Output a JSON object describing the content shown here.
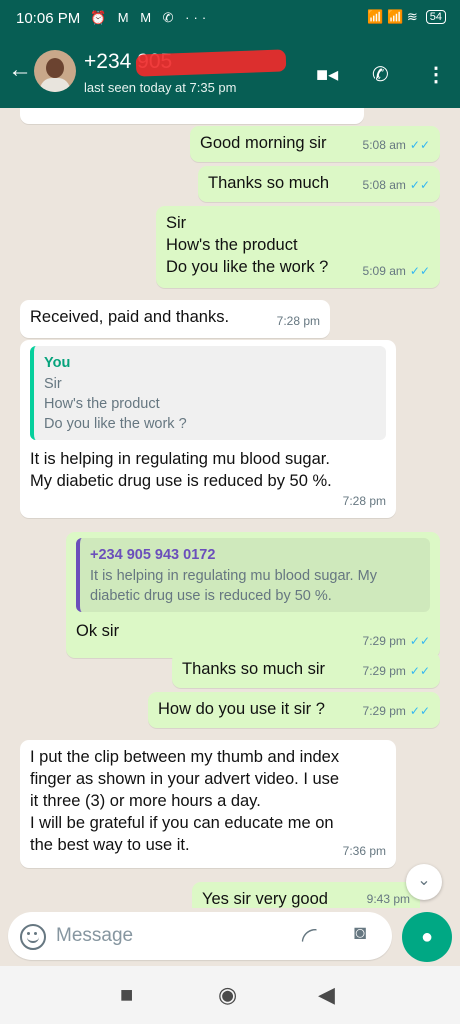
{
  "status_bar": {
    "time": "10:06 PM",
    "left_icons": "⏰ M M ✆ ···",
    "right_icons": "📶 📶 ≋",
    "battery": "54"
  },
  "header": {
    "contact_name": "+234 905",
    "last_seen": "last seen today at 7:35 pm",
    "icons": [
      "back-arrow-icon",
      "video-call-icon",
      "phone-icon",
      "more-vert-icon"
    ]
  },
  "messages": [
    {
      "dir": "out",
      "text": "Good morning sir",
      "time": "5:08 am"
    },
    {
      "dir": "out",
      "text": "Thanks so much",
      "time": "5:08 am"
    },
    {
      "dir": "out",
      "lines": [
        "Sir",
        "How's the product",
        "Do you like the work ?"
      ],
      "time": "5:09 am"
    },
    {
      "dir": "in",
      "text": "Received, paid and thanks.",
      "time": "7:28 pm"
    },
    {
      "dir": "in",
      "quote": {
        "name": "You",
        "lines": [
          "Sir",
          "How's the product",
          "Do you like the work ?"
        ]
      },
      "text_lines": [
        "It is helping in regulating mu blood sugar.",
        "My diabetic drug use is reduced by 50 %."
      ],
      "time": "7:28 pm"
    },
    {
      "dir": "out",
      "quote": {
        "name": "+234 905 943 0172",
        "lines": [
          "It is helping in regulating mu blood sugar. My",
          "diabetic drug use is reduced by 50 %."
        ]
      },
      "text": "Ok sir",
      "time": "7:29 pm"
    },
    {
      "dir": "out",
      "text": "Thanks so much sir",
      "time": "7:29 pm"
    },
    {
      "dir": "out",
      "text": "How do you use it sir ?",
      "time": "7:29 pm"
    },
    {
      "dir": "in",
      "lines": [
        "I put the clip between my thumb and index",
        "finger as shown in your advert video. I use",
        "it three (3) or more hours a day.",
        "I will be grateful if you can educate me on",
        "the best way to use it."
      ],
      "time": "7:36 pm"
    },
    {
      "dir": "out",
      "text": "Yes sir very good",
      "time": "9:43 pm"
    }
  ],
  "composer": {
    "placeholder": "Message"
  },
  "colors": {
    "header": "#075e54",
    "outgoing_bubble": "#dcf8c6",
    "incoming_bubble": "#ffffff",
    "read_tick": "#34b7f1",
    "mic_button": "#00a884"
  }
}
